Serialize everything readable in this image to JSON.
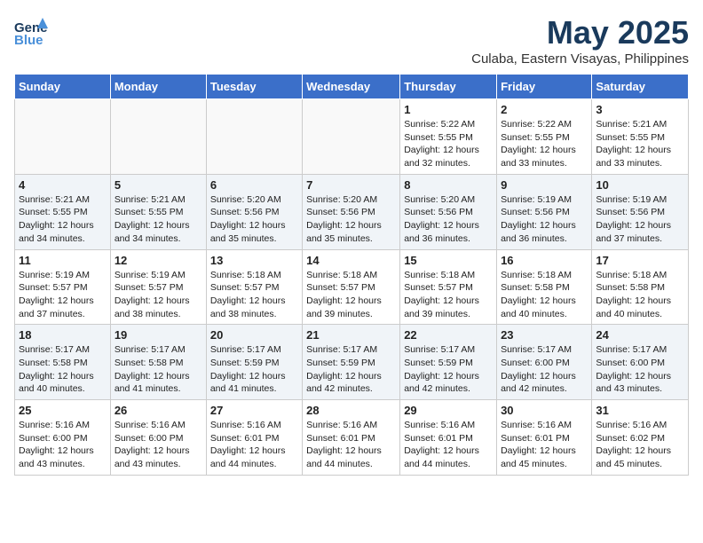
{
  "logo": {
    "line1": "General",
    "line2": "Blue",
    "tagline": ""
  },
  "title": "May 2025",
  "location": "Culaba, Eastern Visayas, Philippines",
  "days_of_week": [
    "Sunday",
    "Monday",
    "Tuesday",
    "Wednesday",
    "Thursday",
    "Friday",
    "Saturday"
  ],
  "weeks": [
    [
      {
        "num": "",
        "info": ""
      },
      {
        "num": "",
        "info": ""
      },
      {
        "num": "",
        "info": ""
      },
      {
        "num": "",
        "info": ""
      },
      {
        "num": "1",
        "info": "Sunrise: 5:22 AM\nSunset: 5:55 PM\nDaylight: 12 hours\nand 32 minutes."
      },
      {
        "num": "2",
        "info": "Sunrise: 5:22 AM\nSunset: 5:55 PM\nDaylight: 12 hours\nand 33 minutes."
      },
      {
        "num": "3",
        "info": "Sunrise: 5:21 AM\nSunset: 5:55 PM\nDaylight: 12 hours\nand 33 minutes."
      }
    ],
    [
      {
        "num": "4",
        "info": "Sunrise: 5:21 AM\nSunset: 5:55 PM\nDaylight: 12 hours\nand 34 minutes."
      },
      {
        "num": "5",
        "info": "Sunrise: 5:21 AM\nSunset: 5:55 PM\nDaylight: 12 hours\nand 34 minutes."
      },
      {
        "num": "6",
        "info": "Sunrise: 5:20 AM\nSunset: 5:56 PM\nDaylight: 12 hours\nand 35 minutes."
      },
      {
        "num": "7",
        "info": "Sunrise: 5:20 AM\nSunset: 5:56 PM\nDaylight: 12 hours\nand 35 minutes."
      },
      {
        "num": "8",
        "info": "Sunrise: 5:20 AM\nSunset: 5:56 PM\nDaylight: 12 hours\nand 36 minutes."
      },
      {
        "num": "9",
        "info": "Sunrise: 5:19 AM\nSunset: 5:56 PM\nDaylight: 12 hours\nand 36 minutes."
      },
      {
        "num": "10",
        "info": "Sunrise: 5:19 AM\nSunset: 5:56 PM\nDaylight: 12 hours\nand 37 minutes."
      }
    ],
    [
      {
        "num": "11",
        "info": "Sunrise: 5:19 AM\nSunset: 5:57 PM\nDaylight: 12 hours\nand 37 minutes."
      },
      {
        "num": "12",
        "info": "Sunrise: 5:19 AM\nSunset: 5:57 PM\nDaylight: 12 hours\nand 38 minutes."
      },
      {
        "num": "13",
        "info": "Sunrise: 5:18 AM\nSunset: 5:57 PM\nDaylight: 12 hours\nand 38 minutes."
      },
      {
        "num": "14",
        "info": "Sunrise: 5:18 AM\nSunset: 5:57 PM\nDaylight: 12 hours\nand 39 minutes."
      },
      {
        "num": "15",
        "info": "Sunrise: 5:18 AM\nSunset: 5:57 PM\nDaylight: 12 hours\nand 39 minutes."
      },
      {
        "num": "16",
        "info": "Sunrise: 5:18 AM\nSunset: 5:58 PM\nDaylight: 12 hours\nand 40 minutes."
      },
      {
        "num": "17",
        "info": "Sunrise: 5:18 AM\nSunset: 5:58 PM\nDaylight: 12 hours\nand 40 minutes."
      }
    ],
    [
      {
        "num": "18",
        "info": "Sunrise: 5:17 AM\nSunset: 5:58 PM\nDaylight: 12 hours\nand 40 minutes."
      },
      {
        "num": "19",
        "info": "Sunrise: 5:17 AM\nSunset: 5:58 PM\nDaylight: 12 hours\nand 41 minutes."
      },
      {
        "num": "20",
        "info": "Sunrise: 5:17 AM\nSunset: 5:59 PM\nDaylight: 12 hours\nand 41 minutes."
      },
      {
        "num": "21",
        "info": "Sunrise: 5:17 AM\nSunset: 5:59 PM\nDaylight: 12 hours\nand 42 minutes."
      },
      {
        "num": "22",
        "info": "Sunrise: 5:17 AM\nSunset: 5:59 PM\nDaylight: 12 hours\nand 42 minutes."
      },
      {
        "num": "23",
        "info": "Sunrise: 5:17 AM\nSunset: 6:00 PM\nDaylight: 12 hours\nand 42 minutes."
      },
      {
        "num": "24",
        "info": "Sunrise: 5:17 AM\nSunset: 6:00 PM\nDaylight: 12 hours\nand 43 minutes."
      }
    ],
    [
      {
        "num": "25",
        "info": "Sunrise: 5:16 AM\nSunset: 6:00 PM\nDaylight: 12 hours\nand 43 minutes."
      },
      {
        "num": "26",
        "info": "Sunrise: 5:16 AM\nSunset: 6:00 PM\nDaylight: 12 hours\nand 43 minutes."
      },
      {
        "num": "27",
        "info": "Sunrise: 5:16 AM\nSunset: 6:01 PM\nDaylight: 12 hours\nand 44 minutes."
      },
      {
        "num": "28",
        "info": "Sunrise: 5:16 AM\nSunset: 6:01 PM\nDaylight: 12 hours\nand 44 minutes."
      },
      {
        "num": "29",
        "info": "Sunrise: 5:16 AM\nSunset: 6:01 PM\nDaylight: 12 hours\nand 44 minutes."
      },
      {
        "num": "30",
        "info": "Sunrise: 5:16 AM\nSunset: 6:01 PM\nDaylight: 12 hours\nand 45 minutes."
      },
      {
        "num": "31",
        "info": "Sunrise: 5:16 AM\nSunset: 6:02 PM\nDaylight: 12 hours\nand 45 minutes."
      }
    ]
  ]
}
